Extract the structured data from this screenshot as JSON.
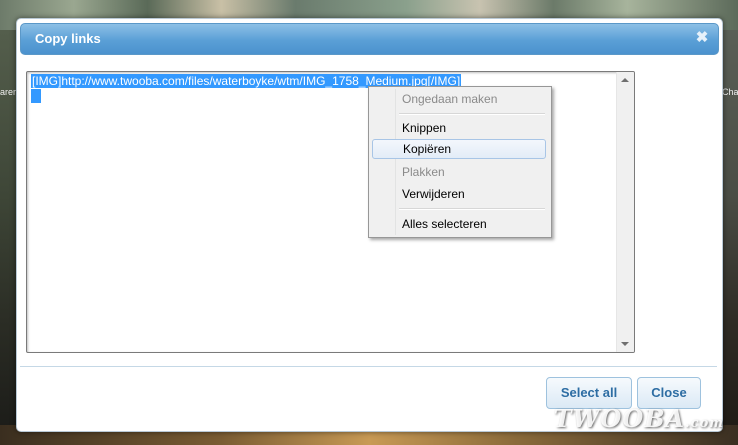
{
  "dialog": {
    "title": "Copy links",
    "close_glyph": "✖",
    "textarea_value": "[IMG]http://www.twooba.com/files/waterboyke/wtm/IMG_1758_Medium.jpg[/IMG]"
  },
  "context_menu": {
    "items": [
      {
        "label": "Ongedaan maken",
        "enabled": false
      },
      {
        "label": "Knippen",
        "enabled": true
      },
      {
        "label": "Kopiëren",
        "enabled": true,
        "hovered": true
      },
      {
        "label": "Plakken",
        "enabled": false
      },
      {
        "label": "Verwijderen",
        "enabled": true
      },
      {
        "label": "Alles selecteren",
        "enabled": true
      }
    ]
  },
  "buttons": {
    "select_all": "Select all",
    "close": "Close"
  },
  "background": {
    "left_text": "arer",
    "right_text": "Cha"
  },
  "watermark": {
    "main": "TWOOBA",
    "suffix": ".com"
  },
  "colors": {
    "titlebar": "#5a9fd6",
    "selection": "#3399ff",
    "button_text": "#2d6da3"
  }
}
